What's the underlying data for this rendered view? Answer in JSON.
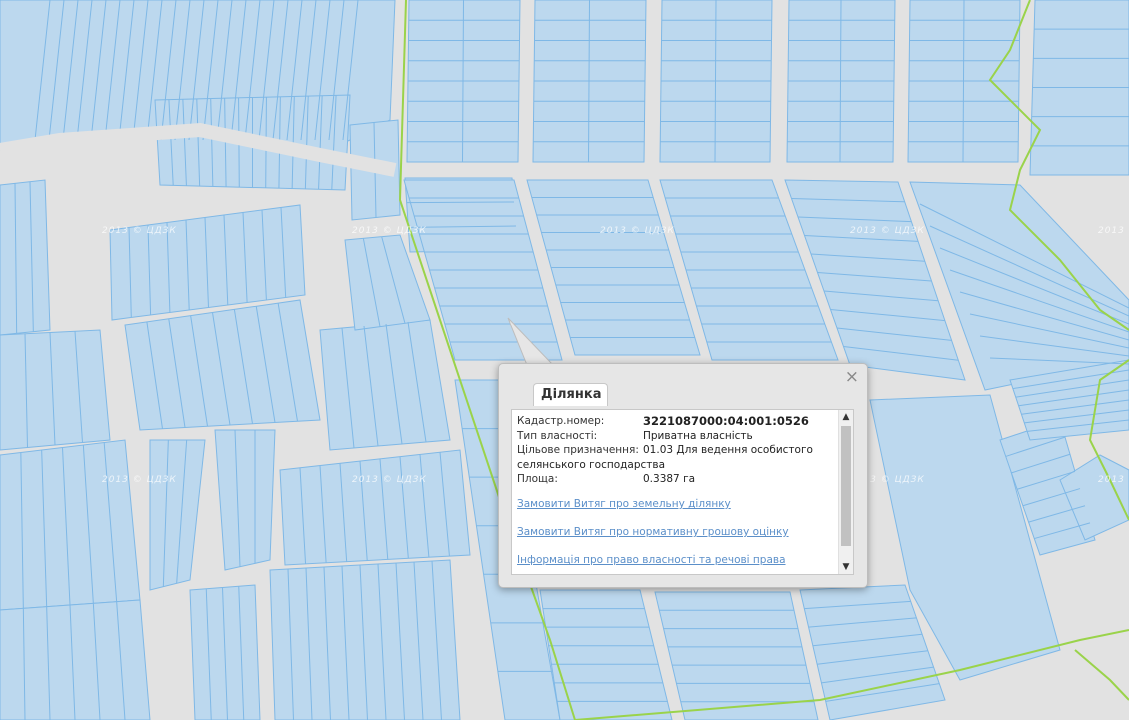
{
  "map": {
    "watermark_text": "2013 © ЦДЗК",
    "colors": {
      "background": "#e2e2e2",
      "parcel_fill": "#bcd8ee",
      "parcel_stroke": "#7fb8e6",
      "boundary": "#9ad34a"
    }
  },
  "popup": {
    "tab_label": "Ділянка",
    "close_symbol": "×",
    "fields": [
      {
        "label": "Кадастр.номер:",
        "value": "3221087000:04:001:0526"
      },
      {
        "label": "Тип власності:",
        "value": "Приватна власність"
      },
      {
        "label": "Цільове призначення:",
        "value": "01.03 Для ведення особистого"
      },
      {
        "label": "",
        "value": "селянського господарства"
      },
      {
        "label": "Площа:",
        "value": "0.3387 га"
      }
    ],
    "links": [
      "Замовити Витяг про земельну ділянку",
      "Замовити Витяг про нормативну грошову оцінку",
      "Інформація про право власності та речові права"
    ],
    "scroll_up": "▲",
    "scroll_down": "▼"
  }
}
